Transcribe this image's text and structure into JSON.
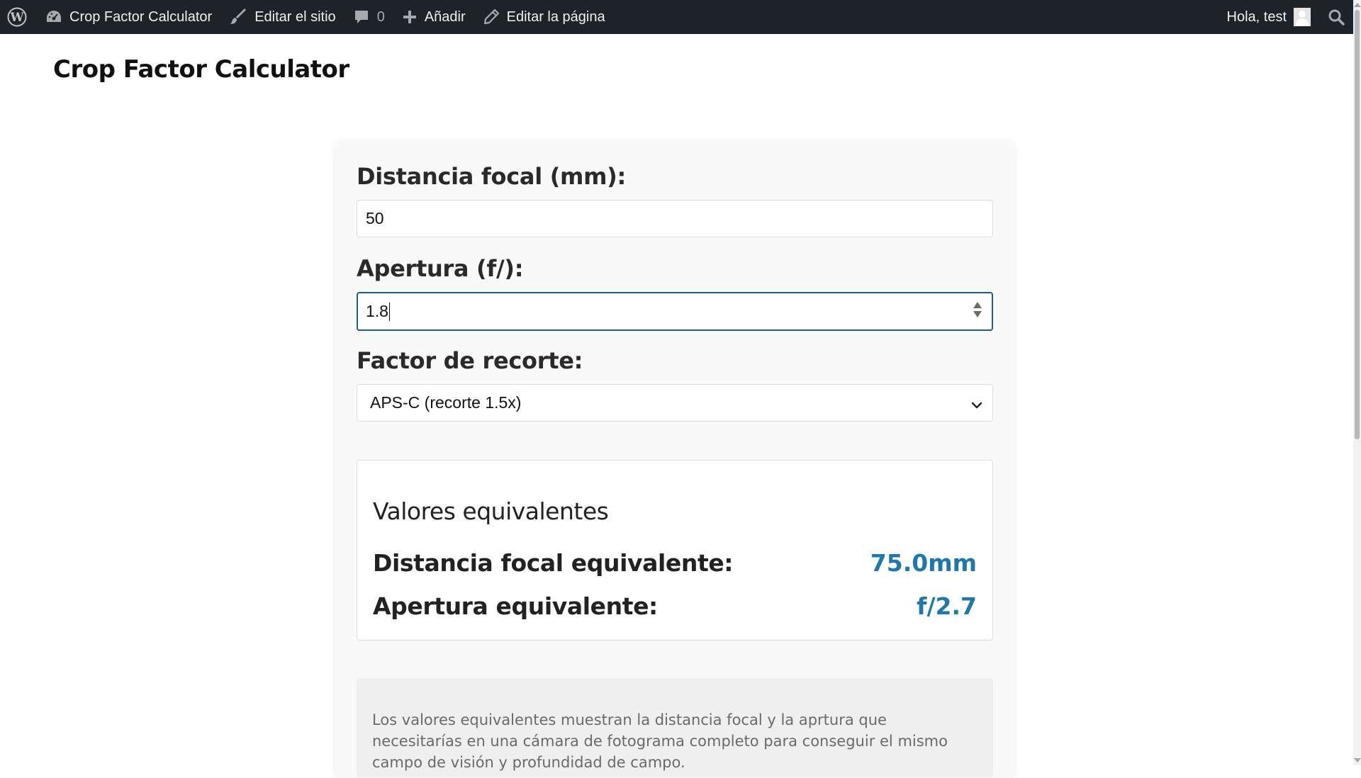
{
  "adminbar": {
    "site_name": "Crop Factor Calculator",
    "edit_site": "Editar el sitio",
    "comments_count": "0",
    "add_new": "Añadir",
    "edit_page": "Editar la página",
    "greeting": "Hola, test",
    "icons": [
      "wordpress-icon",
      "dashboard-icon",
      "brush-icon",
      "comment-icon",
      "plus-icon",
      "pencil-icon",
      "search-icon"
    ]
  },
  "page": {
    "site_title": "Crop Factor Calculator"
  },
  "form": {
    "focal_label": "Distancia focal (mm):",
    "focal_value": "50",
    "aperture_label": "Apertura (f/):",
    "aperture_value": "1.8",
    "crop_label": "Factor de recorte:",
    "crop_selected": "APS-C (recorte 1.5x)"
  },
  "results": {
    "title": "Valores equivalentes",
    "focal_label": "Distancia focal equivalente:",
    "focal_value": "75.0mm",
    "aperture_label": "Apertura equivalente:",
    "aperture_value": "f/2.7"
  },
  "note": {
    "text": "Los valores equivalentes muestran la distancia focal y la aprtura que necesitarías en una cámara de fotograma completo para conseguir el mismo campo de visión y profundidad de campo."
  },
  "colors": {
    "adminbar_bg": "#1d2327",
    "accent_value": "#1e78ad",
    "focus_border": "#1e5f8a"
  }
}
